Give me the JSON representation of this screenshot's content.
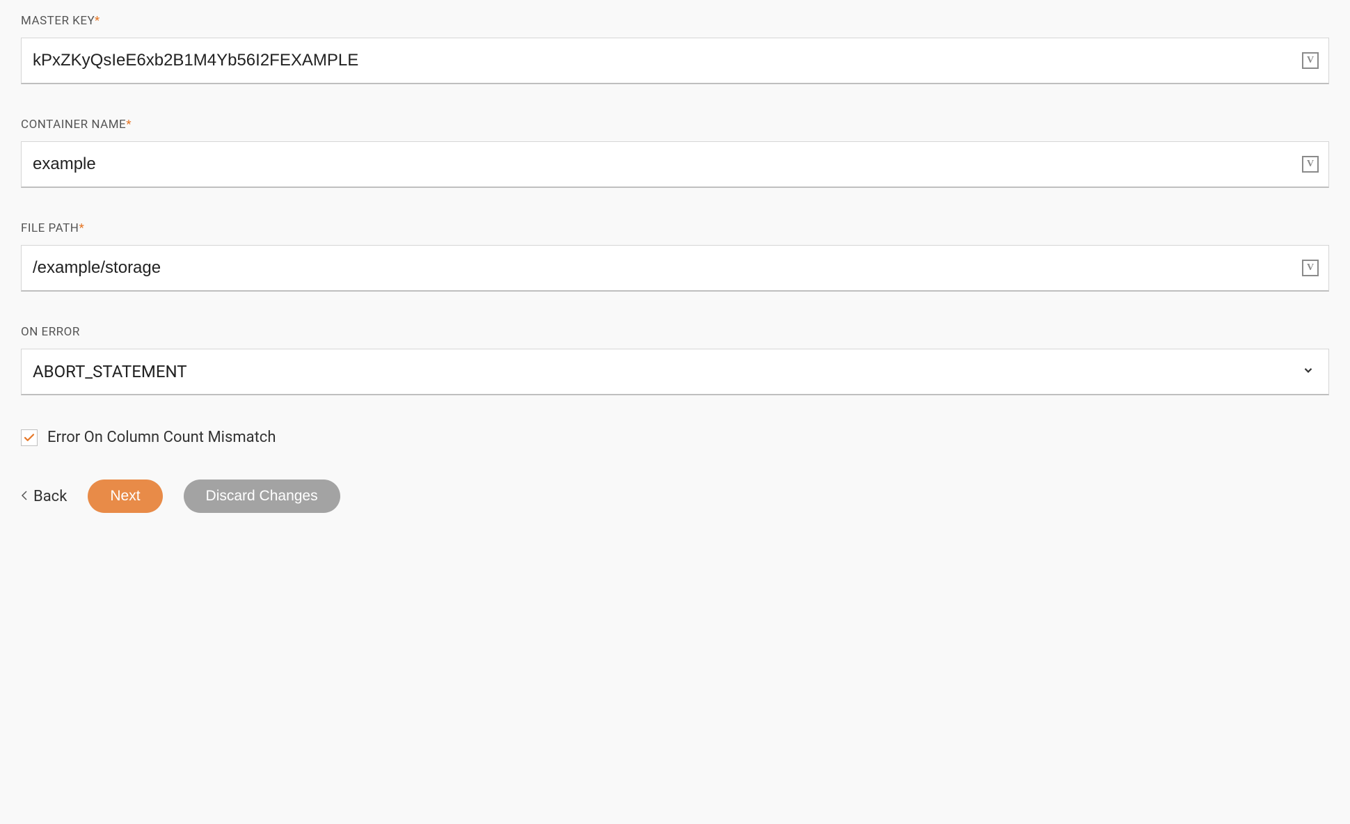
{
  "fields": {
    "master_key": {
      "label": "MASTER KEY",
      "required": "*",
      "value": "kPxZKyQsIeE6xb2B1M4Yb56I2FEXAMPLE"
    },
    "container_name": {
      "label": "CONTAINER NAME",
      "required": "*",
      "value": "example"
    },
    "file_path": {
      "label": "FILE PATH",
      "required": "*",
      "value": "/example/storage"
    },
    "on_error": {
      "label": "ON ERROR",
      "value": "ABORT_STATEMENT"
    }
  },
  "checkbox": {
    "error_on_column_mismatch": {
      "label": "Error On Column Count Mismatch",
      "checked": true
    }
  },
  "buttons": {
    "back": "Back",
    "next": "Next",
    "discard": "Discard Changes"
  },
  "icons": {
    "variable": "V"
  }
}
